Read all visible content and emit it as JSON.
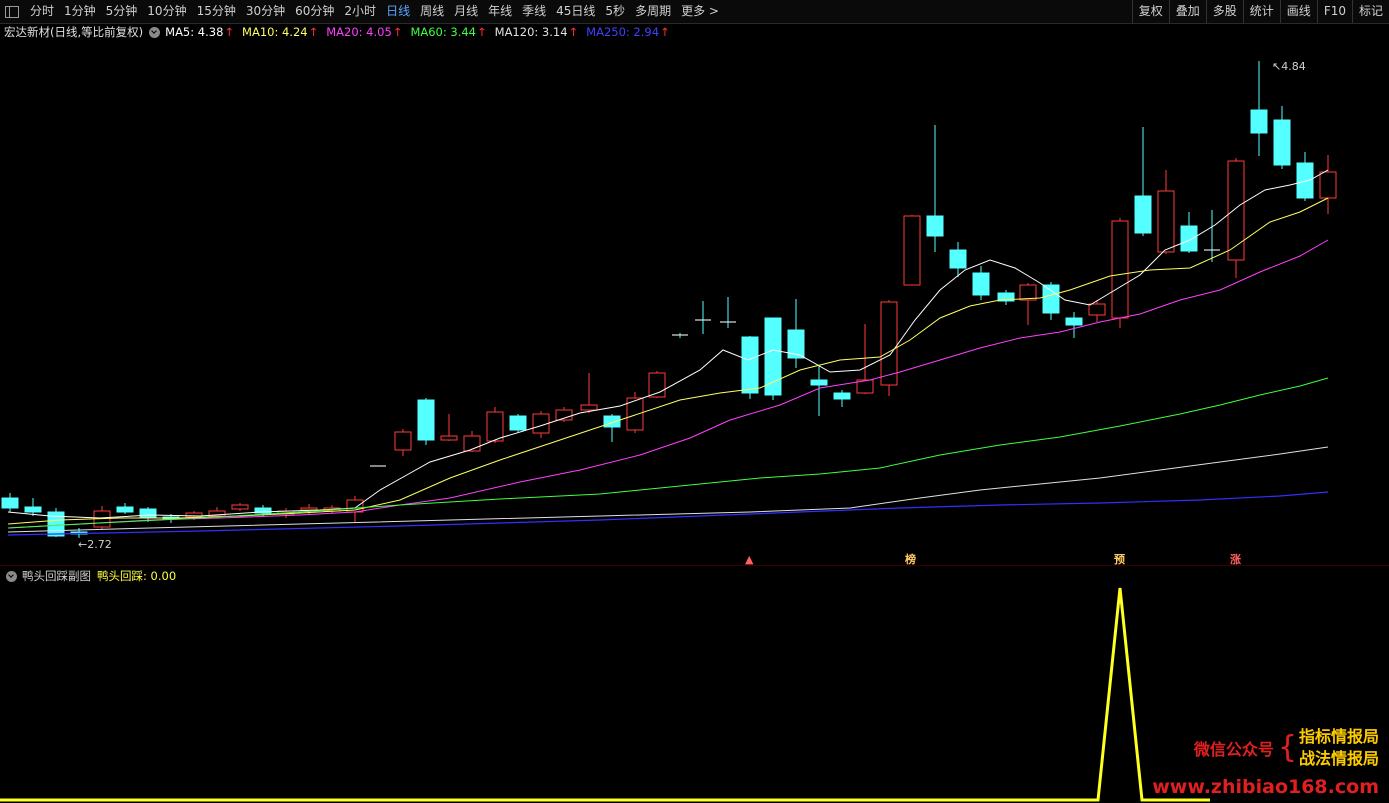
{
  "toolbar": {
    "periods": [
      "分时",
      "1分钟",
      "5分钟",
      "10分钟",
      "15分钟",
      "30分钟",
      "60分钟",
      "2小时",
      "日线",
      "周线",
      "月线",
      "年线",
      "季线",
      "45日线",
      "5秒",
      "多周期",
      "更多 >"
    ],
    "active": "日线",
    "right_buttons": [
      "复权",
      "叠加",
      "多股",
      "统计",
      "画线",
      "F10",
      "标记"
    ]
  },
  "main": {
    "stock_name": "宏达新材(日线,等比前复权)",
    "ma": [
      {
        "label": "MA5: 4.38",
        "color": "#ffffff"
      },
      {
        "label": "MA10: 4.24",
        "color": "#ffff60"
      },
      {
        "label": "MA20: 4.05",
        "color": "#ff40ff"
      },
      {
        "label": "MA60: 3.44",
        "color": "#40ff40"
      },
      {
        "label": "MA120: 3.14",
        "color": "#e0e0e0"
      },
      {
        "label": "MA250: 2.94",
        "color": "#4040ff"
      }
    ],
    "arrow": "↑",
    "high_label": "4.84",
    "low_label": "2.72",
    "marks": [
      {
        "text": "榜",
        "color": "#ffcc66"
      },
      {
        "text": "预",
        "color": "#ffcc66"
      },
      {
        "text": "涨",
        "color": "#ff6060"
      }
    ]
  },
  "sub": {
    "title": "鸭头回踩副图",
    "value_label": "鸭头回踩: 0.00"
  },
  "watermark": {
    "left": "微信公众号",
    "brace": "{",
    "line1": "指标情报局",
    "line2": "战法情报局",
    "url": "www.zhibiao168.com"
  },
  "colors": {
    "up": "#ff3b3b",
    "down": "#54ffff",
    "ma5": "#ffffff",
    "ma10": "#ffff60",
    "ma20": "#ff40ff",
    "ma60": "#40ff40",
    "ma120": "#e0e0e0",
    "ma250": "#3030ff",
    "sub_line": "#ffff20"
  },
  "chart_data": {
    "type": "candlestick",
    "high": 4.84,
    "low": 2.72,
    "indicator": {
      "name": "鸭头回踩",
      "last_value": 0.0
    }
  }
}
